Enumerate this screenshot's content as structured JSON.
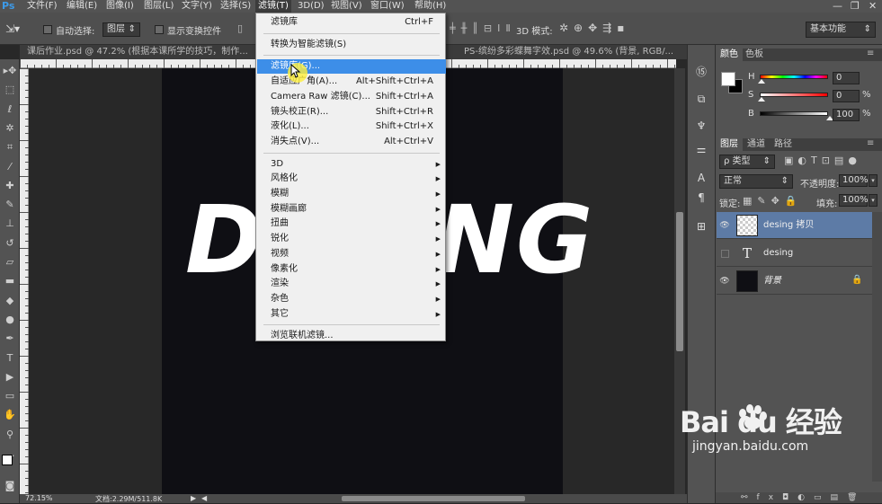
{
  "app": {
    "logo": "Ps"
  },
  "menubar": {
    "items": [
      "文件(F)",
      "编辑(E)",
      "图像(I)",
      "图层(L)",
      "文字(Y)",
      "选择(S)",
      "滤镜(T)",
      "3D(D)",
      "视图(V)",
      "窗口(W)",
      "帮助(H)"
    ],
    "active_index": 6,
    "window_controls": {
      "minimize": "—",
      "restore": "❐",
      "close": "✕"
    }
  },
  "optionsbar": {
    "auto_select_label": "自动选择:",
    "auto_select_value": "图层",
    "show_transform_label": "显示变换控件",
    "mode3d_label": "3D 模式:",
    "workspace": "基本功能"
  },
  "doc_tabs": [
    {
      "title": "课后作业.psd @ 47.2% (根据本课所学的技巧，制作...",
      "active": false
    },
    {
      "title": "PS-缤纷多彩蝶舞字效.psd @ 49.6% (背景, RGB/...",
      "active": false
    }
  ],
  "canvas": {
    "artwork_text": "DESING",
    "artboard_color": "#0f0f14"
  },
  "statusbar": {
    "zoom": "72.15%",
    "doc_info": "文档:2.29M/511.8K"
  },
  "filter_menu": {
    "items": [
      {
        "label": "滤镜库",
        "shortcut": "Ctrl+F",
        "submenu": false,
        "highlight": false
      },
      {
        "sep": true
      },
      {
        "label": "转换为智能滤镜(S)",
        "shortcut": "",
        "submenu": false,
        "highlight": false
      },
      {
        "sep": true
      },
      {
        "label": "滤镜库(G)...",
        "shortcut": "",
        "submenu": false,
        "highlight": true
      },
      {
        "label": "自适应广角(A)...",
        "shortcut": "Alt+Shift+Ctrl+A",
        "submenu": false,
        "highlight": false
      },
      {
        "label": "Camera Raw 滤镜(C)...",
        "shortcut": "Shift+Ctrl+A",
        "submenu": false,
        "highlight": false
      },
      {
        "label": "镜头校正(R)...",
        "shortcut": "Shift+Ctrl+R",
        "submenu": false,
        "highlight": false
      },
      {
        "label": "液化(L)...",
        "shortcut": "Shift+Ctrl+X",
        "submenu": false,
        "highlight": false
      },
      {
        "label": "消失点(V)...",
        "shortcut": "Alt+Ctrl+V",
        "submenu": false,
        "highlight": false
      },
      {
        "sep": true
      },
      {
        "label": "3D",
        "shortcut": "",
        "submenu": true,
        "highlight": false
      },
      {
        "label": "风格化",
        "shortcut": "",
        "submenu": true,
        "highlight": false
      },
      {
        "label": "模糊",
        "shortcut": "",
        "submenu": true,
        "highlight": false
      },
      {
        "label": "模糊画廊",
        "shortcut": "",
        "submenu": true,
        "highlight": false
      },
      {
        "label": "扭曲",
        "shortcut": "",
        "submenu": true,
        "highlight": false
      },
      {
        "label": "锐化",
        "shortcut": "",
        "submenu": true,
        "highlight": false
      },
      {
        "label": "视频",
        "shortcut": "",
        "submenu": true,
        "highlight": false
      },
      {
        "label": "像素化",
        "shortcut": "",
        "submenu": true,
        "highlight": false
      },
      {
        "label": "渲染",
        "shortcut": "",
        "submenu": true,
        "highlight": false
      },
      {
        "label": "杂色",
        "shortcut": "",
        "submenu": true,
        "highlight": false
      },
      {
        "label": "其它",
        "shortcut": "",
        "submenu": true,
        "highlight": false
      },
      {
        "sep": true
      },
      {
        "label": "浏览联机滤镜...",
        "shortcut": "",
        "submenu": false,
        "highlight": false
      }
    ]
  },
  "color_panel": {
    "tabs": [
      "颜色",
      "色板"
    ],
    "channels": [
      {
        "label": "H",
        "value": "0",
        "unit": "",
        "marker": 0.0
      },
      {
        "label": "S",
        "value": "0",
        "unit": "%",
        "marker": 0.0
      },
      {
        "label": "B",
        "value": "100",
        "unit": "%",
        "marker": 1.0
      }
    ],
    "foreground": "#ffffff",
    "background": "#000000"
  },
  "layers_panel": {
    "tabs": [
      "图层",
      "通道",
      "路径"
    ],
    "filter_label": "ρ 类型",
    "blend_mode": "正常",
    "opacity_label": "不透明度:",
    "opacity_value": "100%",
    "lock_label": "锁定:",
    "fill_label": "填充:",
    "fill_value": "100%",
    "layers": [
      {
        "name": "desing 拷贝",
        "kind": "smart",
        "visible": true,
        "selected": true
      },
      {
        "name": "desing",
        "kind": "text",
        "visible": false,
        "selected": false
      },
      {
        "name": "背景",
        "kind": "background",
        "visible": true,
        "selected": false
      }
    ]
  },
  "watermark": {
    "line1": "Bai du 经验",
    "line2": "jingyan.baidu.com"
  },
  "colors": {
    "accent": "#3d8ee8",
    "layer_selected": "#5d7ba6",
    "ui_panel": "#535353"
  }
}
